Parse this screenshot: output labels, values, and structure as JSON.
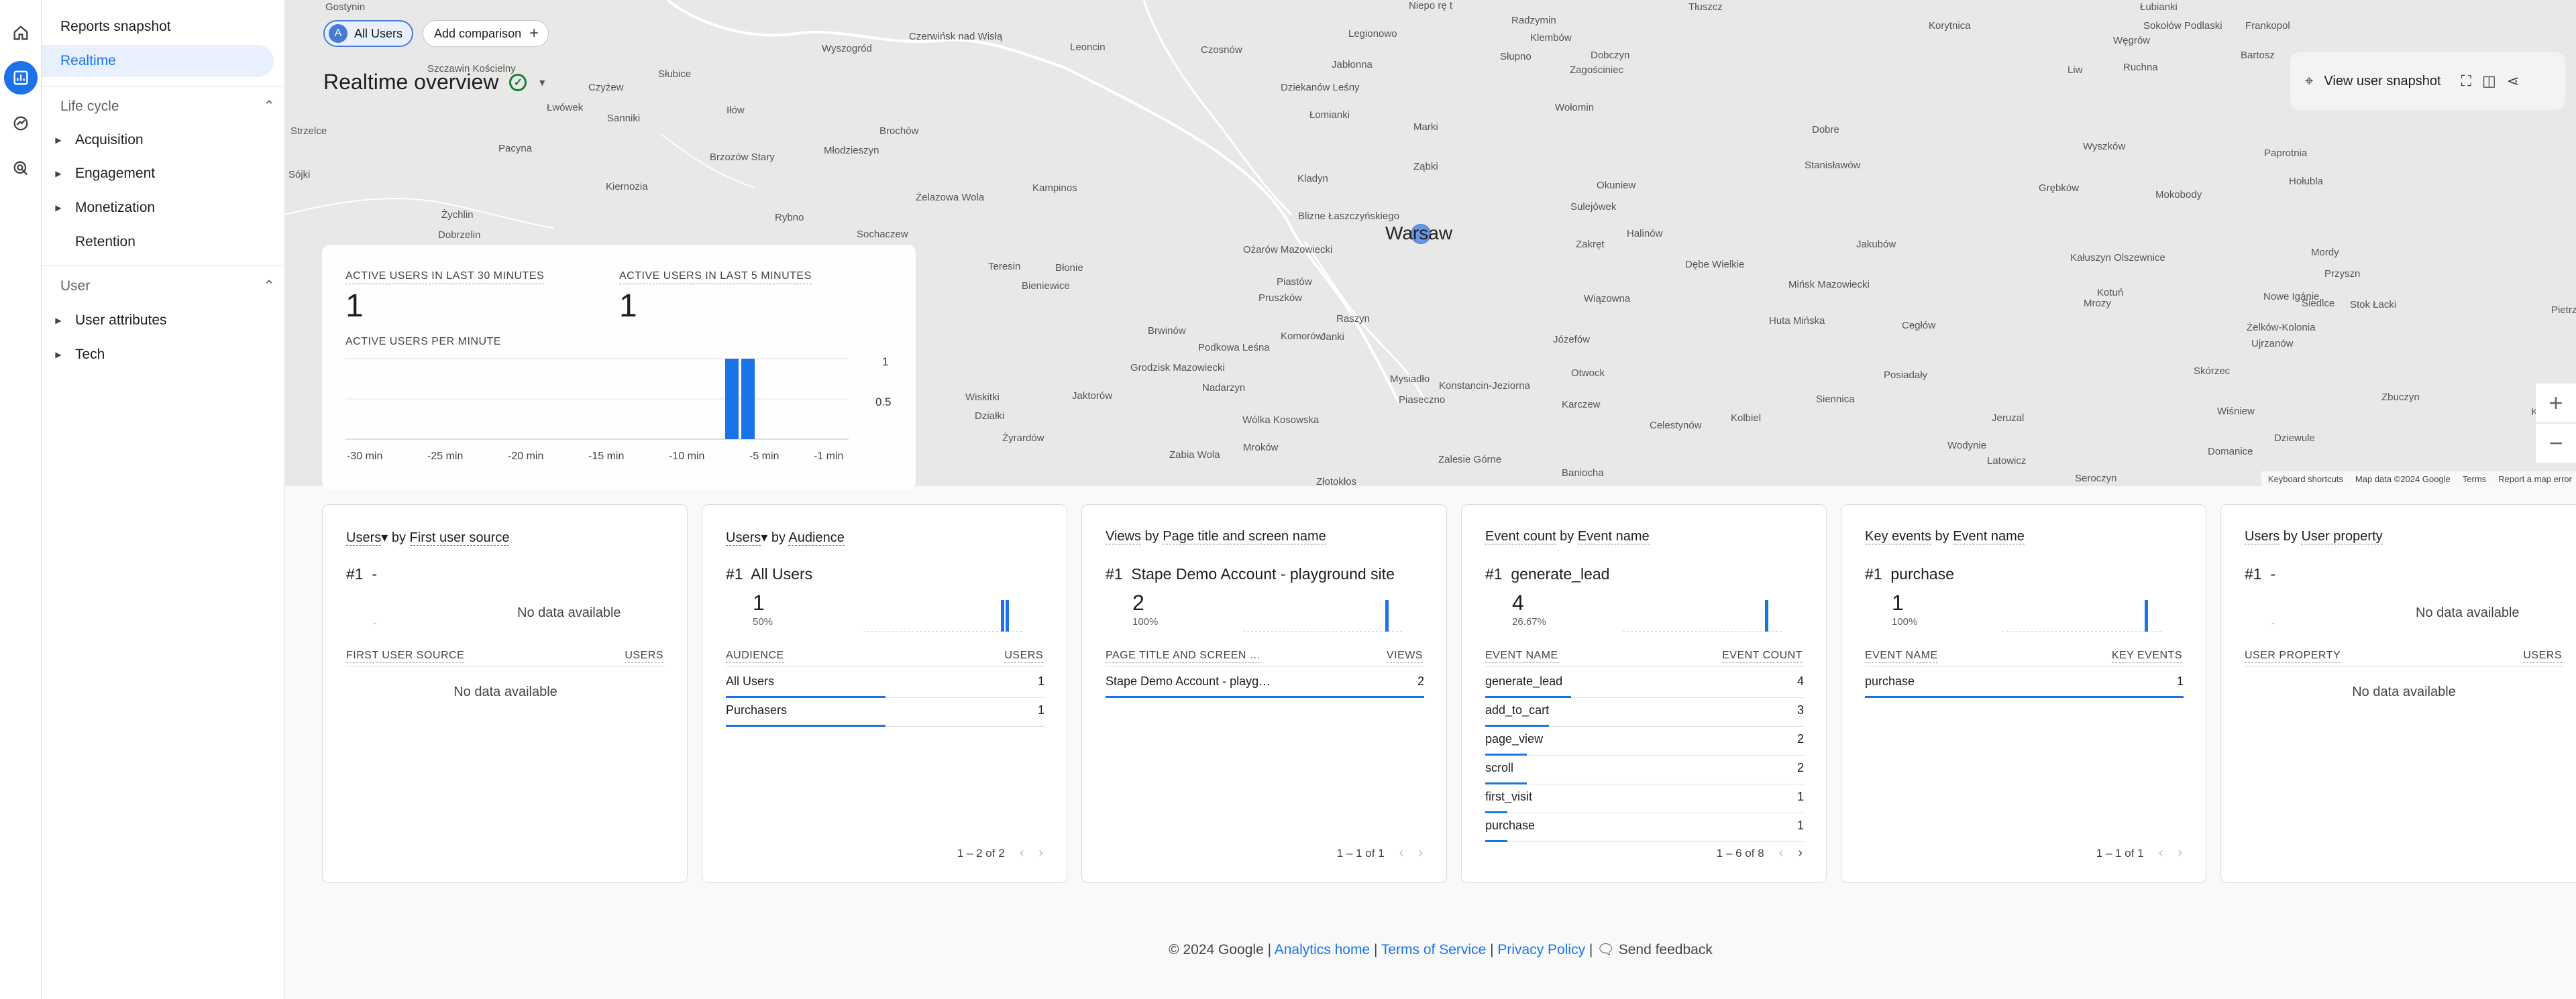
{
  "nav": {
    "reports_snapshot": "Reports snapshot",
    "realtime": "Realtime",
    "lifecycle": "Life cycle",
    "acquisition": "Acquisition",
    "engagement": "Engagement",
    "monetization": "Monetization",
    "retention": "Retention",
    "user": "User",
    "user_attributes": "User attributes",
    "tech": "Tech"
  },
  "chips": {
    "avatar": "A",
    "all_users": "All Users",
    "add_comparison": "Add comparison"
  },
  "title": "Realtime overview",
  "snapshot": "View user snapshot",
  "map": {
    "center_label": "Warsaw",
    "footer": [
      "Keyboard shortcuts",
      "Map data ©2024 Google",
      "Terms",
      "Report a map error"
    ],
    "cities": [
      "Gostynin",
      "Niepo rę t",
      "Radzymin",
      "Tłuszcz",
      "Korytnica",
      "Łubianki",
      "Sokołów Podlaski",
      "Frankopol",
      "Czerwińsk nad Wisłą",
      "Legionowo",
      "Klembów",
      "Węgrów",
      "Wyszogród",
      "Leoncin",
      "Czosnów",
      "Jabłonna",
      "Słupno",
      "Dobczyn",
      "Zagościniec",
      "Liw",
      "Ruchna",
      "Bartosz",
      "Szczawin Kościelny",
      "Słubice",
      "Dziekanów Leśny",
      "Czyżew",
      "Łomianki",
      "Wołomin",
      "Łwówek",
      "Sanniki",
      "Iłów",
      "Brochów",
      "Marki",
      "Dobre",
      "Wyszków",
      "Pacyna",
      "Brzozów Stary",
      "Młodzieszyn",
      "Ząbki",
      "Stanisławów",
      "Paprotnia",
      "Strzelce",
      "Kiernozia",
      "Żelazowa Wola",
      "Kampinos",
      "Kladyn",
      "Okuniew",
      "Grębków",
      "Mokobody",
      "Hołubla",
      "Sójki",
      "Rybno",
      "Sulejówek",
      "Żychlin",
      "Sochaczew",
      "Blizne Łaszczyńskiego",
      "Halinów",
      "Jakubów",
      "Dobrzelin",
      "Ożarów Mazowiecki",
      "Zakręt",
      "Dębe Wielkie",
      "Kałuszyn Olszewnice",
      "Mordy",
      "Teresin",
      "Błonie",
      "Piastów",
      "Mińsk Mazowiecki",
      "Przyszn",
      "Bieniewice",
      "Pruszków",
      "Wiązowna",
      "Mrozy",
      "Kotuń",
      "Nowe Igánie",
      "Siedlce",
      "Stok Łacki",
      "Raszyn",
      "Huta Mińska",
      "Cegłów",
      "Żelków-Kolonia",
      "Brwinów",
      "Komorów",
      "Janki",
      "Józefów",
      "Ujrzanów",
      "Podkowa Leśna",
      "Grodzisk Mazowiecki",
      "Otwock",
      "Posiadały",
      "Skórzec",
      "Mysiadło",
      "Konstancin-Jeziorna",
      "Wiskitki",
      "Jaktorów",
      "Nadarzyn",
      "Piaseczno",
      "Karczew",
      "Siennica",
      "Zbuczyn",
      "Działki",
      "Wólka Kosowska",
      "Celestynów",
      "Kolbiel",
      "Jeruzal",
      "Wiśniew",
      "Krzesk-K",
      "Żyrardów",
      "Mroków",
      "Wodynie",
      "Dziewule",
      "Zabia Wola",
      "Zalesie Górne",
      "Baniocha",
      "Latowicz",
      "Seroczyn",
      "Domanice",
      "Złotokłos",
      "Pietrz"
    ]
  },
  "active": {
    "label_30": "ACTIVE USERS IN LAST 30 MINUTES",
    "value_30": "1",
    "label_5": "ACTIVE USERS IN LAST 5 MINUTES",
    "value_5": "1",
    "per_minute": "ACTIVE USERS PER MINUTE",
    "y_ticks": [
      "1",
      "0.5"
    ],
    "x_ticks": [
      "-30 min",
      "-25 min",
      "-20 min",
      "-15 min",
      "-10 min",
      "-5 min",
      "-1 min"
    ]
  },
  "chart_data": {
    "type": "bar",
    "title": "ACTIVE USERS PER MINUTE",
    "xlabel": "",
    "ylabel": "",
    "ylim": [
      0,
      1
    ],
    "grid": true,
    "bars": [
      {
        "minute": -6,
        "value": 1
      },
      {
        "minute": -5,
        "value": 1
      }
    ]
  },
  "cards": [
    {
      "title_a": "Users",
      "title_mid": " by ",
      "title_b": "First user source",
      "dropdown": "▾",
      "top": "#1  -",
      "no_data": "No data available",
      "dot": "-",
      "col1": "FIRST USER SOURCE",
      "col2": "USERS",
      "table_no_data": "No data available"
    },
    {
      "title_a": "Users",
      "title_mid": " by ",
      "title_b": "Audience",
      "dropdown": "▾",
      "top": "#1  All Users",
      "big": "1",
      "pct": "50%",
      "col1": "AUDIENCE",
      "col2": "USERS",
      "rows": [
        {
          "name": "All Users",
          "value": "1",
          "fill": 0.5
        },
        {
          "name": "Purchasers",
          "value": "1",
          "fill": 0.5
        }
      ],
      "pager": "1 – 2 of 2"
    },
    {
      "title_a": "Views",
      "title_mid": " by ",
      "title_b": "Page title and screen name",
      "top": "#1  Stape Demo Account - playground site",
      "big": "2",
      "pct": "100%",
      "col1": "PAGE TITLE AND SCREEN …",
      "col2": "VIEWS",
      "rows": [
        {
          "name": "Stape Demo Account - playg…",
          "value": "2",
          "fill": 1.0
        }
      ],
      "pager": "1 – 1 of 1"
    },
    {
      "title_a": "Event count",
      "title_mid": " by ",
      "title_b": "Event name",
      "top": "#1  generate_lead",
      "big": "4",
      "pct": "26.67%",
      "col1": "EVENT NAME",
      "col2": "EVENT COUNT",
      "rows": [
        {
          "name": "generate_lead",
          "value": "4",
          "fill": 0.27
        },
        {
          "name": "add_to_cart",
          "value": "3",
          "fill": 0.2
        },
        {
          "name": "page_view",
          "value": "2",
          "fill": 0.13
        },
        {
          "name": "scroll",
          "value": "2",
          "fill": 0.13
        },
        {
          "name": "first_visit",
          "value": "1",
          "fill": 0.07
        },
        {
          "name": "purchase",
          "value": "1",
          "fill": 0.07
        }
      ],
      "pager": "1 – 6 of 8"
    },
    {
      "title_a": "Key events",
      "title_mid": " by ",
      "title_b": "Event name",
      "top": "#1  purchase",
      "big": "1",
      "pct": "100%",
      "col1": "EVENT NAME",
      "col2": "KEY EVENTS",
      "rows": [
        {
          "name": "purchase",
          "value": "1",
          "fill": 1.0
        }
      ],
      "pager": "1 – 1 of 1"
    },
    {
      "title_a": "Users",
      "title_mid": " by ",
      "title_b": "User property",
      "top": "#1  -",
      "no_data": "No data available",
      "dot": "-",
      "col1": "USER PROPERTY",
      "col2": "USERS",
      "table_no_data": "No data available"
    }
  ],
  "footer": {
    "copyright": "© 2024 Google | ",
    "analytics_home": "Analytics home",
    "sep": " | ",
    "terms": "Terms of Service",
    "privacy": "Privacy Policy",
    "feedback": "Send feedback"
  }
}
